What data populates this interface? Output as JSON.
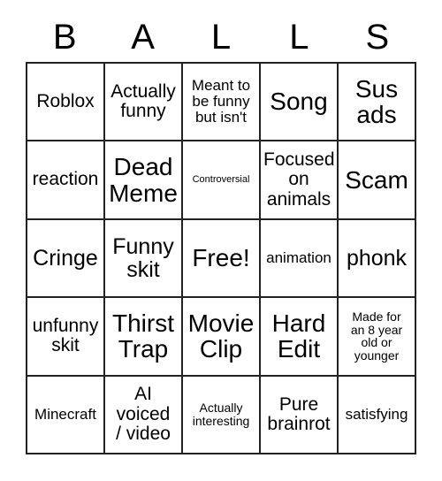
{
  "card": {
    "title_letters": [
      "B",
      "A",
      "L",
      "L",
      "S"
    ],
    "columns": 5,
    "rows": 5,
    "border_color": "#222222",
    "text_color": "#000000",
    "background_color": "#ffffff",
    "cells": [
      [
        {
          "text": "Roblox",
          "size": "md"
        },
        {
          "text": "Actually\nfunny",
          "size": "md"
        },
        {
          "text": "Meant to\nbe funny\nbut isn't",
          "size": "sm"
        },
        {
          "text": "Song",
          "size": "xl"
        },
        {
          "text": "Sus\nads",
          "size": "xl"
        }
      ],
      [
        {
          "text": "reaction",
          "size": "md"
        },
        {
          "text": "Dead\nMeme",
          "size": "xl"
        },
        {
          "text": "Controversial",
          "size": "xxs"
        },
        {
          "text": "Focused\non\nanimals",
          "size": "md"
        },
        {
          "text": "Scam",
          "size": "xl"
        }
      ],
      [
        {
          "text": "Cringe",
          "size": "lg"
        },
        {
          "text": "Funny\nskit",
          "size": "lg"
        },
        {
          "text": "Free!",
          "size": "xl"
        },
        {
          "text": "animation",
          "size": "sm"
        },
        {
          "text": "phonk",
          "size": "lg"
        }
      ],
      [
        {
          "text": "unfunny\nskit",
          "size": "md"
        },
        {
          "text": "Thirst\nTrap",
          "size": "xl"
        },
        {
          "text": "Movie\nClip",
          "size": "xl"
        },
        {
          "text": "Hard\nEdit",
          "size": "xl"
        },
        {
          "text": "Made for\nan 8 year\nold or\nyounger",
          "size": "xs"
        }
      ],
      [
        {
          "text": "Minecraft",
          "size": "sm"
        },
        {
          "text": "AI\nvoiced\n/ video",
          "size": "md"
        },
        {
          "text": "Actually\ninteresting",
          "size": "xs"
        },
        {
          "text": "Pure\nbrainrot",
          "size": "md"
        },
        {
          "text": "satisfying",
          "size": "sm"
        }
      ]
    ]
  }
}
